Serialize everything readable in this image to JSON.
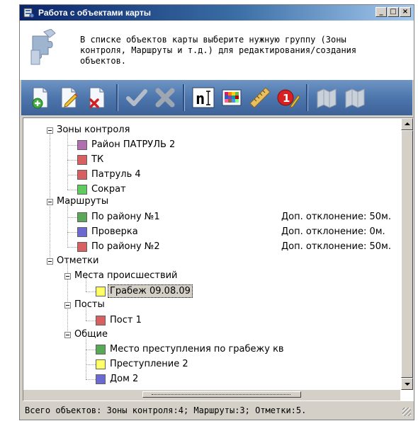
{
  "window": {
    "title": "Работа с объектами карты",
    "buttons": {
      "minimize": "_",
      "maximize": "□",
      "close": "×"
    }
  },
  "header": {
    "hint": "В списке объектов карты выберите нужную группу (Зоны контроля, Маршруты и т.д.) для редактирования/создания объектов."
  },
  "toolbar": {
    "buttons": [
      {
        "icon": "add-document-icon"
      },
      {
        "icon": "edit-document-icon"
      },
      {
        "icon": "delete-document-icon"
      },
      {
        "icon": "accept-check-icon",
        "disabled": true
      },
      {
        "icon": "cancel-x-icon",
        "disabled": true
      },
      {
        "icon": "text-label-icon",
        "glyph": "n"
      },
      {
        "icon": "color-palette-icon"
      },
      {
        "icon": "ruler-icon"
      },
      {
        "icon": "numbered-marker-icon",
        "glyph": "1"
      },
      {
        "icon": "map-back-icon",
        "disabled": true
      },
      {
        "icon": "map-forward-icon",
        "disabled": true
      }
    ]
  },
  "tree": {
    "groups": [
      {
        "label": "Зоны контроля",
        "items": [
          {
            "label": "Район ПАТРУЛЬ 2",
            "color": "#b070b0"
          },
          {
            "label": "ТК",
            "color": "#d86060"
          },
          {
            "label": "Патруль 4",
            "color": "#d86060"
          },
          {
            "label": "Сократ",
            "color": "#5ccc5c"
          }
        ]
      },
      {
        "label": "Маршруты",
        "items": [
          {
            "label": "По району №1",
            "color": "#58a858",
            "deviation": "Доп. отклонение: 50м."
          },
          {
            "label": "Проверка",
            "color": "#6a6ad0",
            "deviation": "Доп. отклонение: 0м."
          },
          {
            "label": "По району №2",
            "color": "#d86060",
            "deviation": "Доп. отклонение: 50м."
          }
        ]
      },
      {
        "label": "Отметки",
        "subgroups": [
          {
            "label": "Места происшествий",
            "items": [
              {
                "label": "Грабеж 09.08.09",
                "color": "#ffff66",
                "selected": true
              }
            ]
          },
          {
            "label": "Посты",
            "items": [
              {
                "label": "Пост 1",
                "color": "#d86060"
              }
            ]
          },
          {
            "label": "Общие",
            "items": [
              {
                "label": "Место преступления по грабежу кв",
                "color": "#58a858"
              },
              {
                "label": "Преступление 2",
                "color": "#ffff66"
              },
              {
                "label": "Дом 2",
                "color": "#6a6ad0"
              }
            ]
          }
        ]
      }
    ]
  },
  "status": {
    "text": "Всего объектов: Зоны контроля:4; Маршруты:3; Отметки:5."
  }
}
